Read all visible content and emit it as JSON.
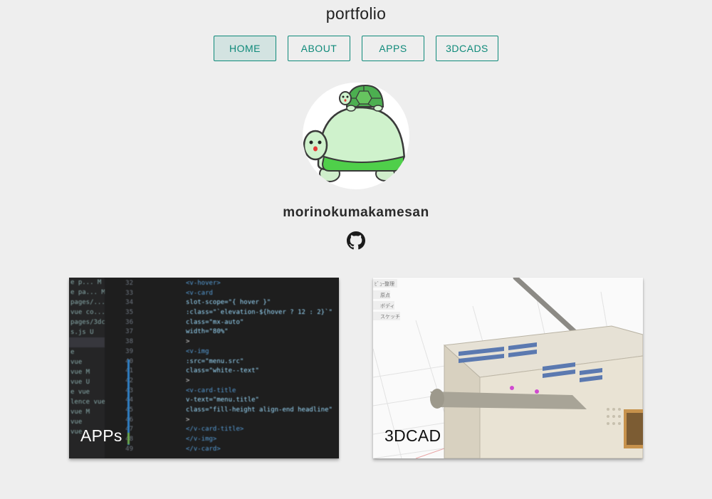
{
  "header": {
    "title": "portfolio"
  },
  "nav": {
    "items": [
      {
        "label": "HOME",
        "active": true
      },
      {
        "label": "ABOUT",
        "active": false
      },
      {
        "label": "APPS",
        "active": false
      },
      {
        "label": "3DCADS",
        "active": false
      }
    ]
  },
  "profile": {
    "username": "morinokumakamesan",
    "avatar_icon": "turtle-avatar-icon",
    "github_icon": "github-icon"
  },
  "cards": [
    {
      "title": "APPs",
      "image": "code-editor-screenshot"
    },
    {
      "title": "3DCAD",
      "image": "3d-cad-model-render"
    }
  ],
  "code_preview": {
    "line_numbers": [
      "32",
      "33",
      "34",
      "35",
      "36",
      "37",
      "38",
      "39",
      "40",
      "41",
      "42",
      "43",
      "44",
      "45",
      "46",
      "47",
      "48",
      "49"
    ],
    "explorer_items": [
      "e p... M",
      "e pa... M",
      "pages/...",
      "vue co...",
      "pages/3dc...",
      "s.js U",
      "",
      "e",
      "vue",
      "vue M",
      "vue U",
      "e vue",
      "lence vue",
      "vue M",
      "vue",
      "vue"
    ],
    "lines": [
      "<v-hover>",
      "  <v-card",
      "    slot-scope=\"{ hover }\"",
      "    :class=\"`elevation-${hover ? 12 : 2}`\"",
      "    class=\"mx-auto\"",
      "    width=\"80%\"",
      "  >",
      "    <v-img",
      "      :src=\"menu.src\"",
      "      class=\"white--text\"",
      "    >",
      "      <v-card-title",
      "        v-text=\"menu.title\"",
      "        class=\"fill-height align-end headline\"",
      "      >",
      "      </v-card-title>",
      "    </v-img>",
      "  </v-card>"
    ]
  },
  "cad_preview": {
    "browser_items": [
      "ﾋﾞｭｰ整理",
      "原点",
      "ボディ",
      "スケッチ"
    ]
  },
  "colors": {
    "background": "#eeeeee",
    "accent": "#0f8a7a",
    "active_nav_bg": "#d3e3e1"
  }
}
